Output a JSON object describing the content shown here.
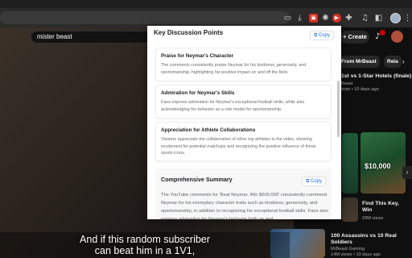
{
  "browser": {
    "toolbar_icons": [
      "picture-in-picture-icon",
      "download-icon",
      "extension-red-icon",
      "gear-icon",
      "youtube-summary-extension-icon",
      "puzzle-icon",
      "media-control-icon",
      "sidebar-icon",
      "profile-avatar-icon",
      "more-vert-icon"
    ],
    "accent": "#d93025"
  },
  "youtube": {
    "search_value": "mister beast",
    "create_label": "+ Create",
    "chips": [
      "From MrBeast",
      "Rela"
    ],
    "recommendations": [
      {
        "title": "1st vs 1-Star Hotels (finale)",
        "channel": "Beast",
        "meta": "iews • 10 days ago"
      },
      {
        "title": "Find This Key, Win",
        "thumb_text": "$10,000",
        "meta": "29M views"
      },
      {
        "title": "100 Assassins vs 10 Real Soldiers",
        "channel": "MrBeast Gaming",
        "meta": "14M views • 10 days ago"
      }
    ],
    "caption_lines": [
      "And if this random subscriber",
      "can beat him in a 1V1,"
    ]
  },
  "panel": {
    "title": "Key Discussion Points",
    "copy_label": "Copy",
    "cards": [
      {
        "title": "Praise for Neymar's Character",
        "body": "The comments consistently praise Neymar for his kindness, generosity, and sportsmanship, highlighting his positive impact on and off the field."
      },
      {
        "title": "Admiration for Neymar's Skills",
        "body": "Fans express admiration for Neymar's exceptional football skills, while also acknowledging his behavior as a role model for sportsmanship."
      },
      {
        "title": "Appreciation for Athlete Collaborations",
        "body": "Viewers appreciate the collaboration of other top athletes in the video, showing excitement for potential matchups and recognizing the positive influence of these sports icons."
      }
    ],
    "summary": {
      "title": "Comprehensive Summary",
      "copy_label": "Copy",
      "body": "The YouTube comments for 'Beat Neymar, Win $500,000' consistently commend Neymar for his exemplary character traits such as kindness, generosity, and sportsmanship, in addition to recognizing his exceptional football skills. Fans also express admiration for Neymar's behavior both on and"
    }
  }
}
